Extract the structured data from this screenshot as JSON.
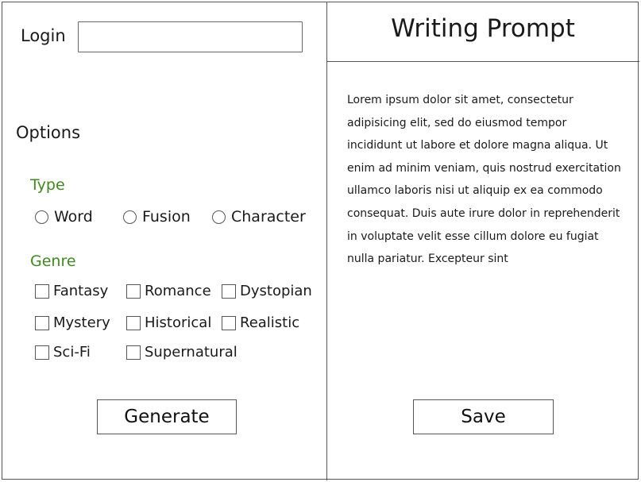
{
  "login": {
    "label": "Login",
    "value": ""
  },
  "options": {
    "title": "Options",
    "type": {
      "label": "Type",
      "choices": [
        "Word",
        "Fusion",
        "Character"
      ]
    },
    "genre": {
      "label": "Genre",
      "choices": [
        "Fantasy",
        "Romance",
        "Dystopian",
        "Mystery",
        "Historical",
        "Realistic",
        "Sci-Fi",
        "Supernatural"
      ]
    }
  },
  "buttons": {
    "generate": "Generate",
    "save": "Save"
  },
  "prompt": {
    "title": "Writing Prompt",
    "body": "Lorem ipsum dolor sit amet, consectetur adipisicing elit, sed do eiusmod tempor incididunt ut labore et dolore magna aliqua. Ut enim ad minim veniam, quis nostrud exercitation ullamco laboris nisi ut aliquip ex ea commodo consequat. Duis aute irure dolor in reprehenderit in voluptate velit esse cillum dolore eu fugiat nulla pariatur. Excepteur sint"
  },
  "colors": {
    "section_label": "#3f8a1f",
    "border": "#555555"
  }
}
